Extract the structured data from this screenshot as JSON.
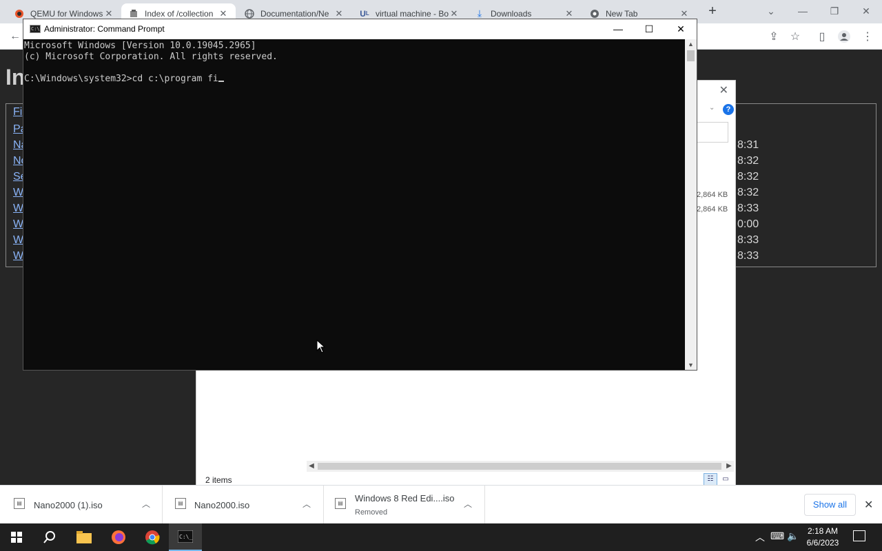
{
  "browser": {
    "tabs": [
      {
        "label": "QEMU for Windows",
        "icon": "qemu-icon",
        "active": false
      },
      {
        "label": "Index of /collection",
        "icon": "archive-icon",
        "active": true
      },
      {
        "label": "Documentation/Ne",
        "icon": "globe-icon",
        "active": false
      },
      {
        "label": "virtual machine - Bo",
        "icon": "ul-icon",
        "active": false
      },
      {
        "label": "Downloads",
        "icon": "download-icon",
        "active": false
      },
      {
        "label": "New Tab",
        "icon": "chrome-icon",
        "active": false
      }
    ],
    "new_tab_label": "+"
  },
  "page": {
    "heading": "In",
    "links": [
      "Fi",
      "Pa",
      "Na",
      "No",
      "Se",
      "W",
      "W",
      "W",
      "W",
      "W"
    ],
    "times": [
      "8:31",
      "8:32",
      "8:32",
      "8:32",
      "8:33",
      "0:00",
      "8:33",
      "8:33"
    ]
  },
  "explorer": {
    "sizes": [
      "2,864 KB",
      "2,864 KB"
    ],
    "status": "2 items",
    "help_label": "?"
  },
  "cmd": {
    "title": "Administrator: Command Prompt",
    "lines": [
      "Microsoft Windows [Version 10.0.19045.2965]",
      "(c) Microsoft Corporation. All rights reserved.",
      "",
      "C:\\Windows\\system32>cd c:\\program fi"
    ]
  },
  "downloads": {
    "items": [
      {
        "name": "Nano2000 (1).iso",
        "status": ""
      },
      {
        "name": "Nano2000.iso",
        "status": ""
      },
      {
        "name": "Windows 8 Red Edi....iso",
        "status": "Removed"
      }
    ],
    "show_all_label": "Show all"
  },
  "taskbar": {
    "time": "2:18 AM",
    "date": "6/6/2023"
  }
}
